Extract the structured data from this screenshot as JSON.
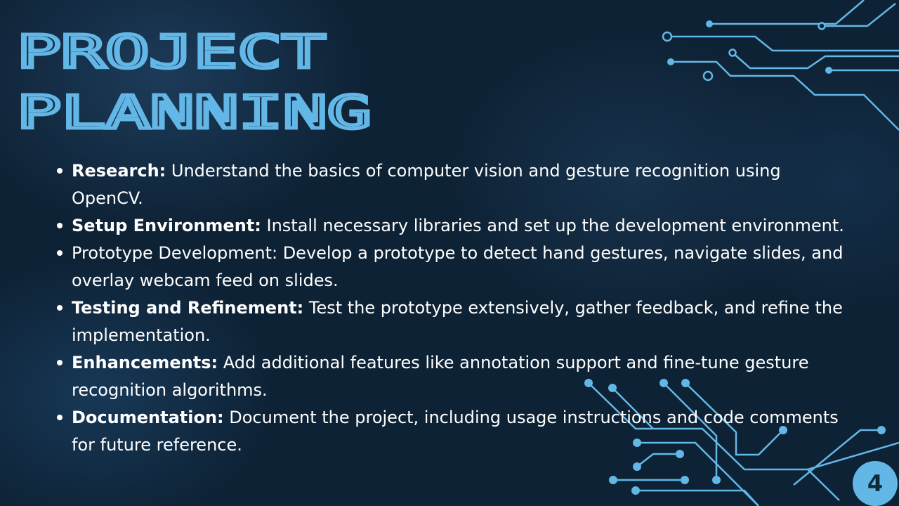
{
  "slide": {
    "title_line1": "PROJECT",
    "title_line2": "PLANNING",
    "page_number": "4",
    "accent_color": "#63b7e6",
    "background_color": "#0e2235"
  },
  "bullets": [
    {
      "term": "Research:",
      "text": " Understand the basics of computer vision and gesture recognition using OpenCV."
    },
    {
      "term": "Setup Environment:",
      "text": " Install necessary libraries and set up the development environment."
    },
    {
      "term": "",
      "text": "Prototype Development: Develop a prototype to detect hand gestures, navigate slides, and overlay webcam feed on slides."
    },
    {
      "term": "Testing and Refinement:",
      "text": " Test the prototype extensively, gather feedback, and refine the implementation."
    },
    {
      "term": "Enhancements:",
      "text": " Add additional features like annotation support and fine-tune gesture recognition algorithms."
    },
    {
      "term": "Documentation:",
      "text": " Document the project, including usage instructions and code comments for future reference."
    }
  ]
}
